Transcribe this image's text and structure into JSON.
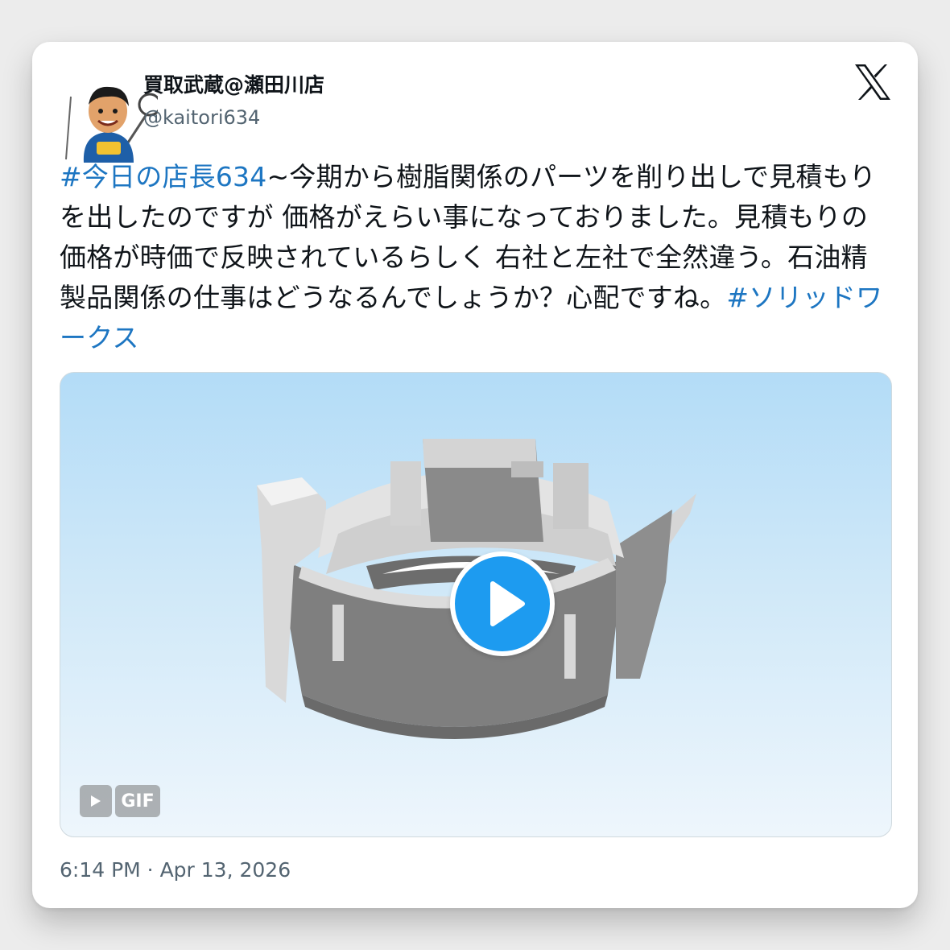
{
  "tweet": {
    "display_name": "買取武蔵@瀬田川店",
    "handle": "@kaitori634",
    "hashtag_1": "#今日の店長634",
    "body": "~今期から樹脂関係のパーツを削り出しで見積もりを出したのですが 価格がえらい事になっておりました。見積もりの価格が時価で反映されているらしく 右社と左社で全然違う。石油精製品関係の仕事はどうなるんでしょうか？心配ですね。",
    "hashtag_2": "#ソリッドワークス",
    "timestamp": "6:14 PM · Apr 13, 2026"
  },
  "media": {
    "type": "GIF",
    "badge_label": "GIF",
    "subject": "3d-ring-part-render"
  },
  "icons": {
    "logo": "x-logo-icon",
    "play": "play-icon",
    "avatar": "mascot-avatar"
  },
  "colors": {
    "hashtag": "#1d76c2",
    "play_button": "#1d9bf0",
    "handle": "#536471",
    "text": "#0f1419"
  }
}
